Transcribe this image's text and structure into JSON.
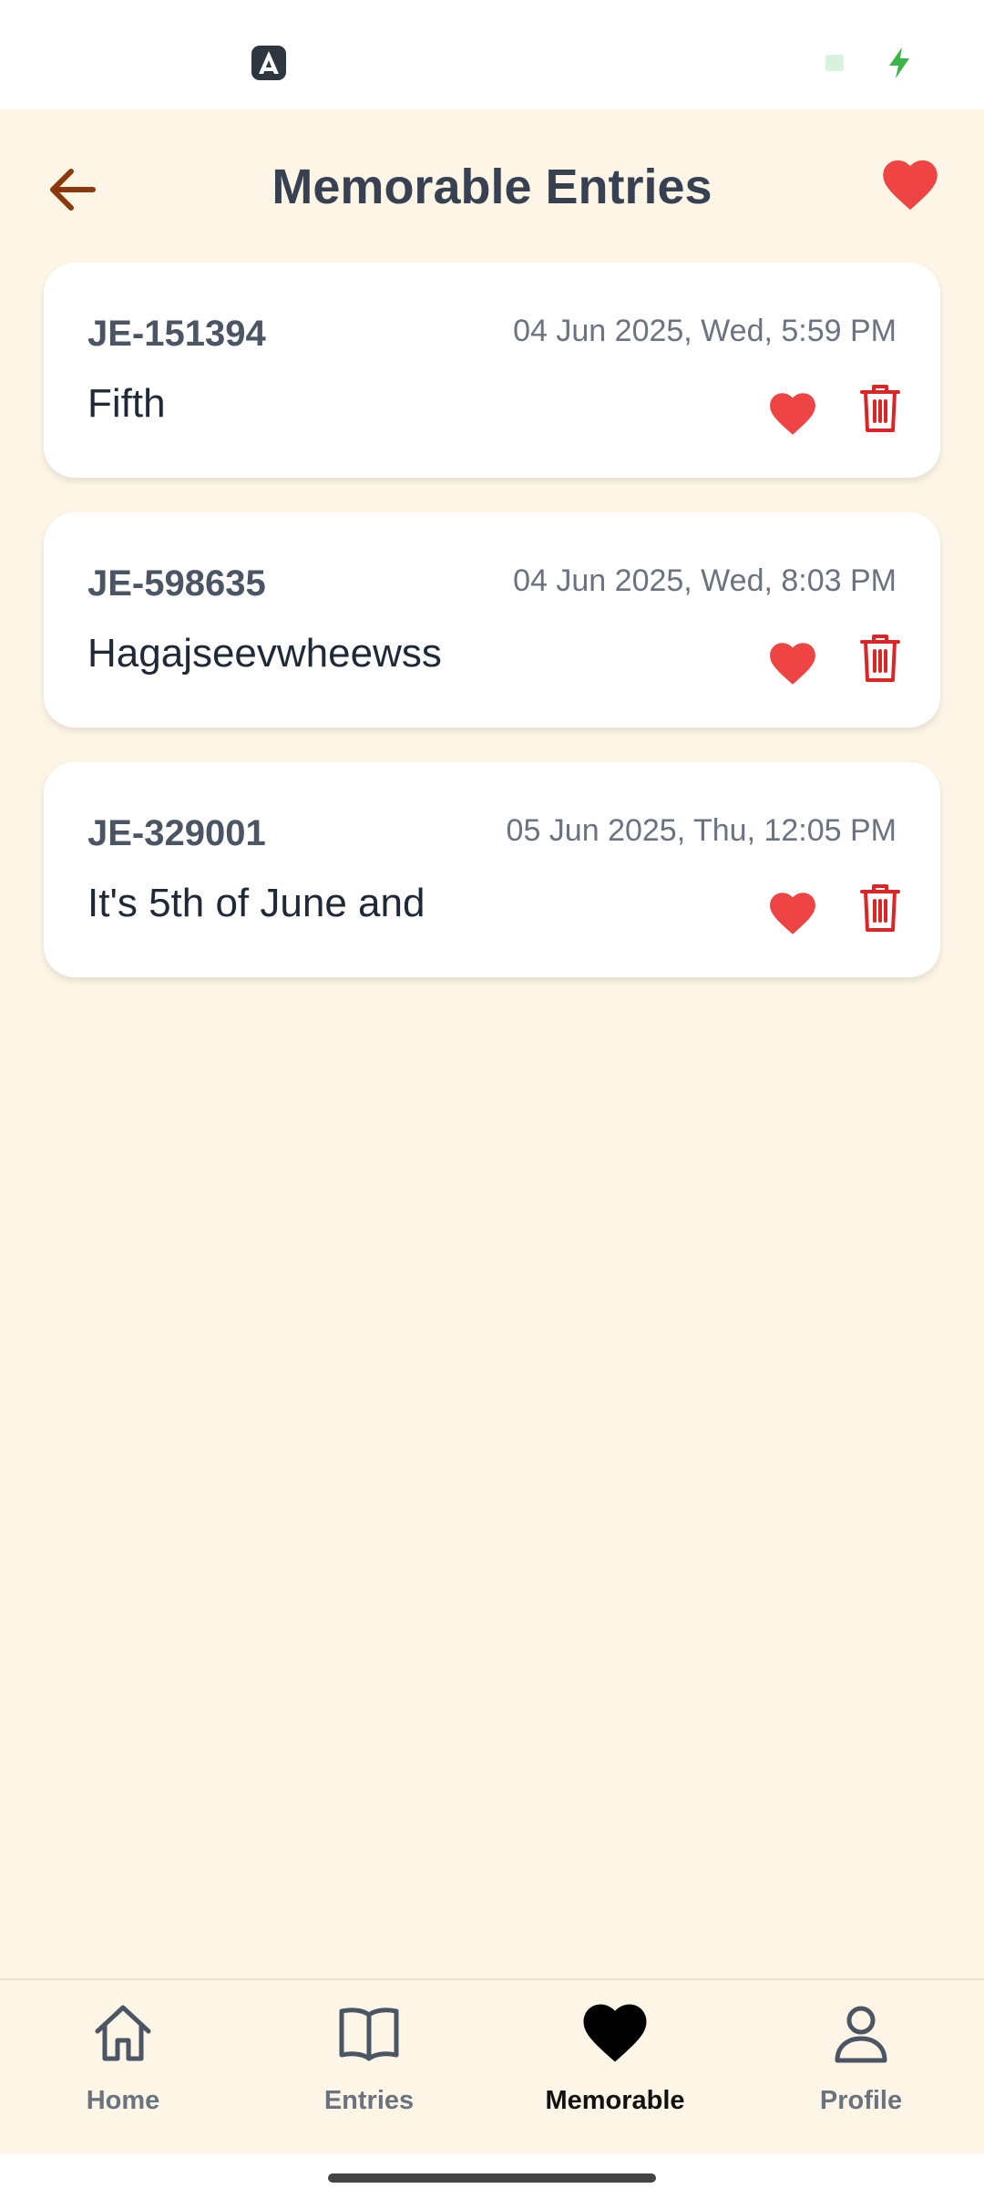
{
  "header": {
    "title": "Memorable Entries"
  },
  "entries": [
    {
      "id": "JE-151394",
      "date": "04 Jun 2025, Wed, 5:59 PM",
      "text": "Fifth"
    },
    {
      "id": "JE-598635",
      "date": "04 Jun 2025, Wed, 8:03 PM",
      "text": "Hagajseevwheewss"
    },
    {
      "id": "JE-329001",
      "date": "05 Jun 2025, Thu, 12:05 PM",
      "text": "It's 5th of June and"
    }
  ],
  "nav": {
    "home": "Home",
    "entries": "Entries",
    "memorable": "Memorable",
    "profile": "Profile",
    "active": "memorable"
  },
  "colors": {
    "background": "#fdf6e6",
    "accent_back": "#8b3a0e",
    "heart": "#ef4444",
    "trash": "#dc2626",
    "title": "#374151"
  },
  "icons": {
    "back": "arrow-left-icon",
    "favorite": "heart-icon",
    "delete": "trash-icon",
    "home": "home-icon",
    "entries": "book-icon",
    "profile": "user-icon"
  }
}
